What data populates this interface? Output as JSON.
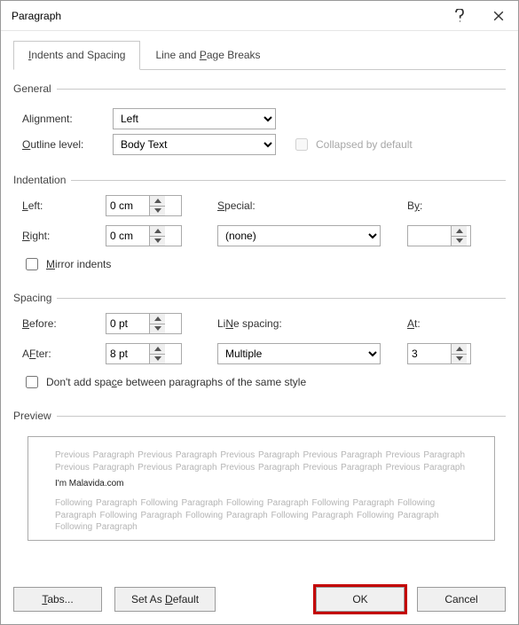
{
  "title": "Paragraph",
  "tabs": {
    "indents": "Indents and Spacing",
    "breaks": "Line and Page Breaks"
  },
  "general": {
    "legend": "General",
    "alignment_label_pre": "Ali",
    "alignment_label_u": "g",
    "alignment_label_post": "nment:",
    "alignment_value": "Left",
    "outline_label_u": "O",
    "outline_label_post": "utline level:",
    "outline_value": "Body Text",
    "collapsed_label": "Collapsed by default"
  },
  "indentation": {
    "legend": "Indentation",
    "left_u": "L",
    "left_post": "eft:",
    "left_value": "0 cm",
    "right_u": "R",
    "right_post": "ight:",
    "right_value": "0 cm",
    "special_u": "S",
    "special_post": "pecial:",
    "special_value": "(none)",
    "by_label": "By:",
    "by_u": "y",
    "by_value": "",
    "mirror_u": "M",
    "mirror_label": "irror indents"
  },
  "spacing": {
    "legend": "Spacing",
    "before_u": "B",
    "before_post": "efore:",
    "before_value": "0 pt",
    "after_u": "F",
    "after_pre": "A",
    "after_post": "ter:",
    "after_value": "8 pt",
    "line_u": "N",
    "line_pre": "Li",
    "line_post": "e spacing:",
    "line_value": "Multiple",
    "at_u": "A",
    "at_post": "t:",
    "at_value": "3",
    "dont_add": "Don't add space between paragraphs of the same style",
    "dont_u": "c"
  },
  "preview": {
    "legend": "Preview",
    "prev_text": "Previous Paragraph Previous Paragraph Previous Paragraph Previous Paragraph Previous Paragraph Previous Paragraph Previous Paragraph Previous Paragraph Previous Paragraph Previous Paragraph",
    "sample": "I'm Malavida.com",
    "next_text": "Following Paragraph Following Paragraph Following Paragraph Following Paragraph Following Paragraph Following Paragraph Following Paragraph Following Paragraph Following Paragraph Following Paragraph"
  },
  "footer": {
    "tabs": "Tabs...",
    "tabs_u": "T",
    "default": "Set As Default",
    "default_u": "D",
    "ok": "OK",
    "cancel": "Cancel"
  }
}
